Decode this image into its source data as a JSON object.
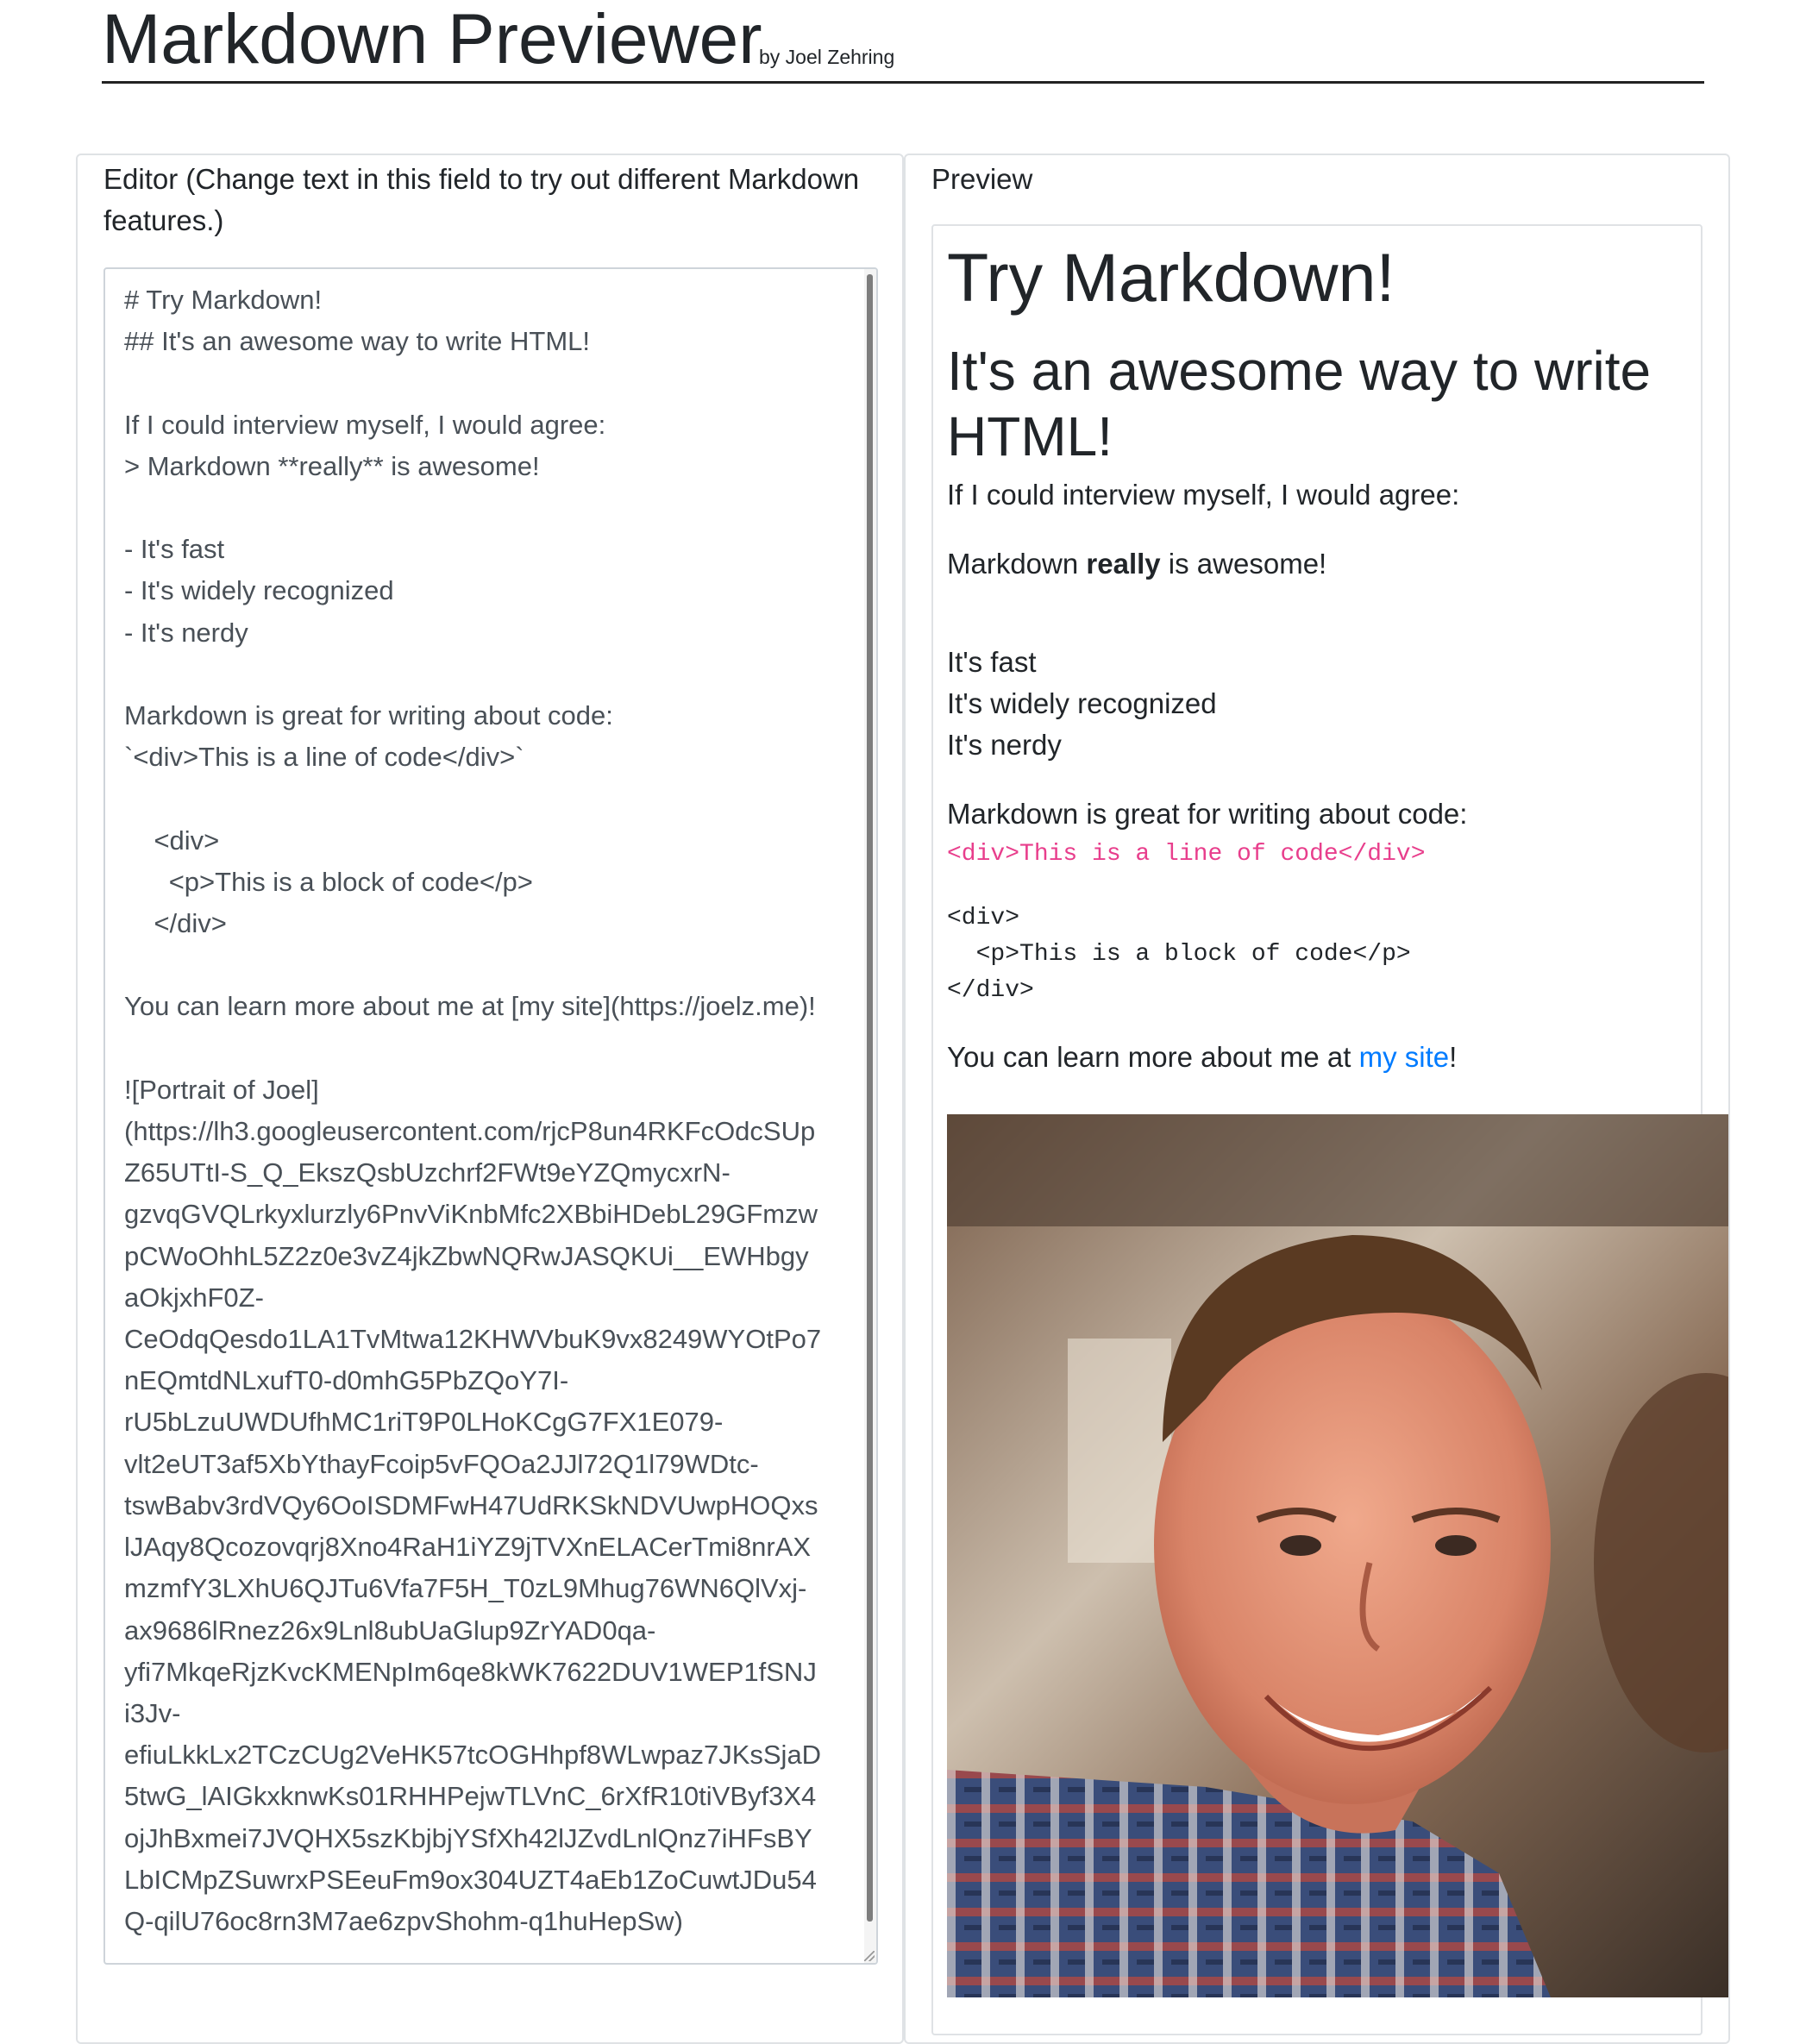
{
  "header": {
    "title": "Markdown Previewer",
    "byline": "by Joel Zehring"
  },
  "editor": {
    "heading": "Editor (Change text in this field to try out different Markdown features.)",
    "content": "# Try Markdown!\n## It's an awesome way to write HTML!\n\nIf I could interview myself, I would agree:\n> Markdown **really** is awesome!\n\n- It's fast\n- It's widely recognized\n- It's nerdy\n\nMarkdown is great for writing about code:\n`<div>This is a line of code</div>`\n\n    <div>\n      <p>This is a block of code</p>\n    </div>\n\nYou can learn more about me at [my site](https://joelz.me)!\n\n![Portrait of Joel]\n(https://lh3.googleusercontent.com/rjcP8un4RKFcOdcSUp\nZ65UTtI-S_Q_EkszQsbUzchrf2FWt9eYZQmycxrN-\ngzvqGVQLrkyxlurzly6PnvViKnbMfc2XBbiHDebL29GFmzw\npCWoOhhL5Z2z0e3vZ4jkZbwNQRwJASQKUi__EWHbgy\naOkjxhF0Z-\nCeOdqQesdo1LA1TvMtwa12KHWVbuK9vx8249WYOtPo7\nnEQmtdNLxufT0-d0mhG5PbZQoY7I-\nrU5bLzuUWDUfhMC1riT9P0LHoKCgG7FX1E079-\nvlt2eUT3af5XbYthayFcoip5vFQOa2JJl72Q1l79WDtc-\ntswBabv3rdVQy6OoISDMFwH47UdRKSkNDVUwpHOQxs\nlJAqy8Qcozovqrj8Xno4RaH1iYZ9jTVXnELACerTmi8nrAX\nmzmfY3LXhU6QJTu6Vfa7F5H_T0zL9Mhug76WN6QlVxj-\nax9686lRnez26x9Lnl8ubUaGlup9ZrYAD0qa-\nyfi7MkqeRjzKvcKMENpIm6qe8kWK7622DUV1WEP1fSNJ\ni3Jv-\nefiuLkkLx2TCzCUg2VeHK57tcOGHhpf8WLwpaz7JKsSjaD\n5twG_lAIGkxknwKs01RHHPejwTLVnC_6rXfR10tiVByf3X4\nojJhBxmei7JVQHX5szKbjbjYSfXh42lJZvdLnlQnz7iHFsBY\nLbICMpZSuwrxPSEeuFm9ox304UZT4aEb1ZoCuwtJDu54\nQ-qilU76oc8rn3M7ae6zpvShohm-q1huHepSw)"
  },
  "preview": {
    "heading": "Preview",
    "h1": "Try Markdown!",
    "h2": "It's an awesome way to write HTML!",
    "p1": "If I could interview myself, I would agree:",
    "quote_before": "Markdown ",
    "quote_bold": "really",
    "quote_after": " is awesome!",
    "list": [
      "It's fast",
      "It's widely recognized",
      "It's nerdy"
    ],
    "p2": "Markdown is great for writing about code:",
    "inline_code": "<div>This is a line of code</div>",
    "code_block": "<div>\n  <p>This is a block of code</p>\n</div>",
    "p3_before": "You can learn more about me at ",
    "p3_link": "my site",
    "p3_after": "!",
    "image_alt": "Portrait of Joel"
  },
  "colors": {
    "link": "#007bff",
    "inline_code": "#e83e8c",
    "text": "#212529",
    "editor_text": "#495057"
  }
}
